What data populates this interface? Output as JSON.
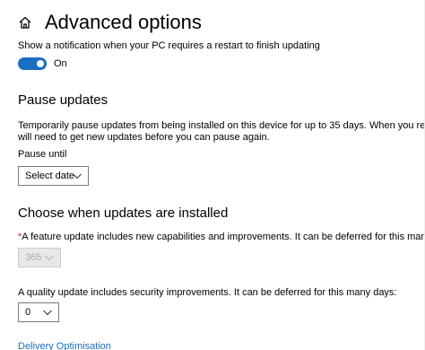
{
  "header": {
    "title": "Advanced options",
    "home_icon": "home-icon"
  },
  "restart_notification": {
    "description": "Show a notification when your PC requires a restart to finish updating",
    "toggle_state": "On",
    "toggle_color": "#1a6fc2"
  },
  "pause_updates": {
    "heading": "Pause updates",
    "description_line1": "Temporarily pause updates from being installed on this device for up to 35 days. When you reach the pa",
    "description_line2": "will need to get new updates before you can pause again.",
    "pause_until_label": "Pause until",
    "dropdown_value": "Select date"
  },
  "choose_when": {
    "heading": "Choose when updates are installed",
    "feature_required_marker": "*",
    "feature_label": "A feature update includes new capabilities and improvements. It can be deferred for this many days:",
    "feature_value": "365",
    "quality_label": "A quality update includes security improvements. It can be deferred for this many days:",
    "quality_value": "0"
  },
  "footer": {
    "link_label": "Delivery Optimisation"
  }
}
